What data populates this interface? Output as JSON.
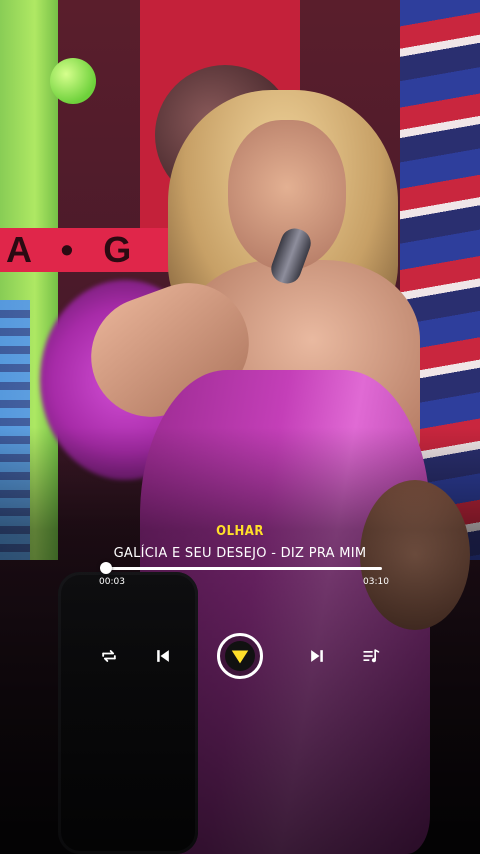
{
  "player": {
    "lyric_line": "OLHAR",
    "song_title": "GALÍCIA E SEU DESEJO - DIZ PRA MIM",
    "elapsed_time": "00:03",
    "total_time": "03:10",
    "progress_fraction": 0.016,
    "accent_color": "#FFDF2A"
  },
  "controls": {
    "repeat_icon": "repeat-icon",
    "previous_icon": "skip-previous-icon",
    "play_icon": "play-pause-icon",
    "next_icon": "skip-next-icon",
    "queue_icon": "playlist-icon"
  }
}
